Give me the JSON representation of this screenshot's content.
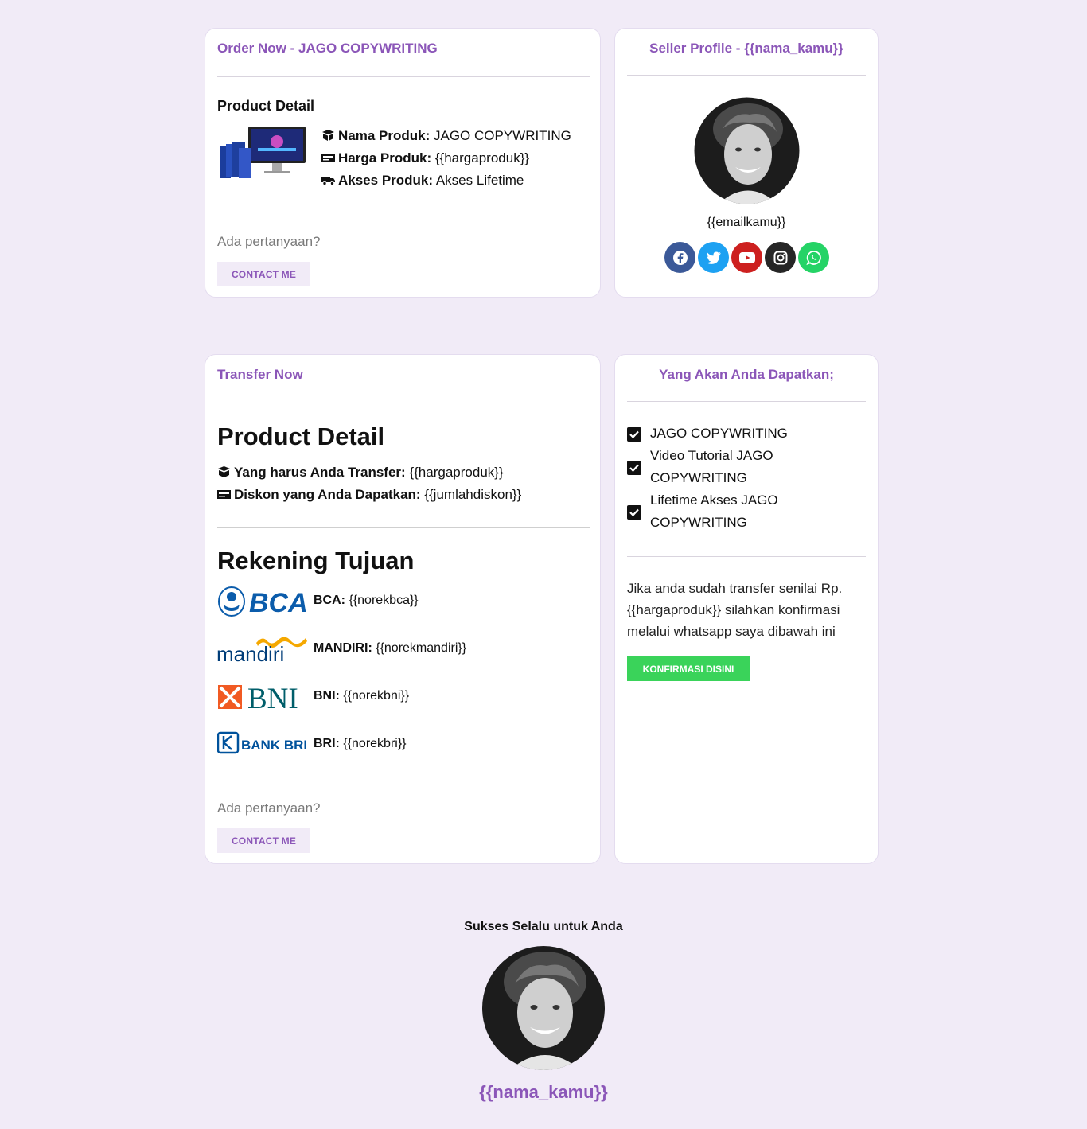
{
  "order_card": {
    "title": "Order Now - JAGO COPYWRITING",
    "section_heading": "Product Detail",
    "details": [
      {
        "icon": "box-open-icon",
        "label": "Nama Produk:",
        "value": "JAGO COPYWRITING"
      },
      {
        "icon": "money-bill-icon",
        "label": "Harga Produk:",
        "value": "{{hargaproduk}}"
      },
      {
        "icon": "shipping-fast-icon",
        "label": "Akses Produk:",
        "value": "Akses Lifetime"
      }
    ],
    "question": "Ada pertanyaan?",
    "contact_label": "CONTACT ME"
  },
  "seller_card": {
    "title": "Seller Profile - {{nama_kamu}}",
    "email": "{{emailkamu}}",
    "socials": [
      {
        "icon": "facebook-icon",
        "color": "#3b5998"
      },
      {
        "icon": "twitter-icon",
        "color": "#1da1f2"
      },
      {
        "icon": "youtube-icon",
        "color": "#cd201f"
      },
      {
        "icon": "instagram-icon",
        "color": "#262626"
      },
      {
        "icon": "whatsapp-icon",
        "color": "#25d366"
      }
    ]
  },
  "transfer_card": {
    "title": "Transfer Now",
    "product_heading": "Product Detail",
    "details": [
      {
        "icon": "box-open-icon",
        "label": "Yang harus Anda Transfer:",
        "value": "{{hargaproduk}}"
      },
      {
        "icon": "money-bill-icon",
        "label": "Diskon yang Anda Dapatkan:",
        "value": "{{jumlahdiskon}}"
      }
    ],
    "rekening_heading": "Rekening Tujuan",
    "banks": [
      {
        "logo": "BCA",
        "label": "BCA:",
        "value": "{{norekbca}}"
      },
      {
        "logo": "mandiri",
        "label": "MANDIRI:",
        "value": "{{norekmandiri}}"
      },
      {
        "logo": "BNI",
        "label": "BNI:",
        "value": "{{norekbni}}"
      },
      {
        "logo": "BANK BRI",
        "label": "BRI:",
        "value": "{{norekbri}}"
      }
    ],
    "question": "Ada pertanyaan?",
    "contact_label": "CONTACT ME"
  },
  "benefits_card": {
    "title": "Yang Akan Anda Dapatkan;",
    "items": [
      {
        "line1": "JAGO COPYWRITING",
        "line2": ""
      },
      {
        "line1": "Video Tutorial JAGO",
        "line2": "COPYWRITING"
      },
      {
        "line1": "Lifetime Akses JAGO",
        "line2": "COPYWRITING"
      }
    ],
    "confirm_lines": [
      "Jika anda sudah transfer senilai Rp.",
      "{{hargaproduk}} silahkan konfirmasi",
      "melalui whatsapp saya dibawah ini"
    ],
    "confirm_button": "KONFIRMASI DISINI",
    "confirm_color": "#3ad35a"
  },
  "footer": {
    "tagline": "Sukses Selalu untuk Anda",
    "name": "{{nama_kamu}}"
  },
  "colors": {
    "accent": "#8b56b8",
    "background": "#f1ebf7"
  }
}
